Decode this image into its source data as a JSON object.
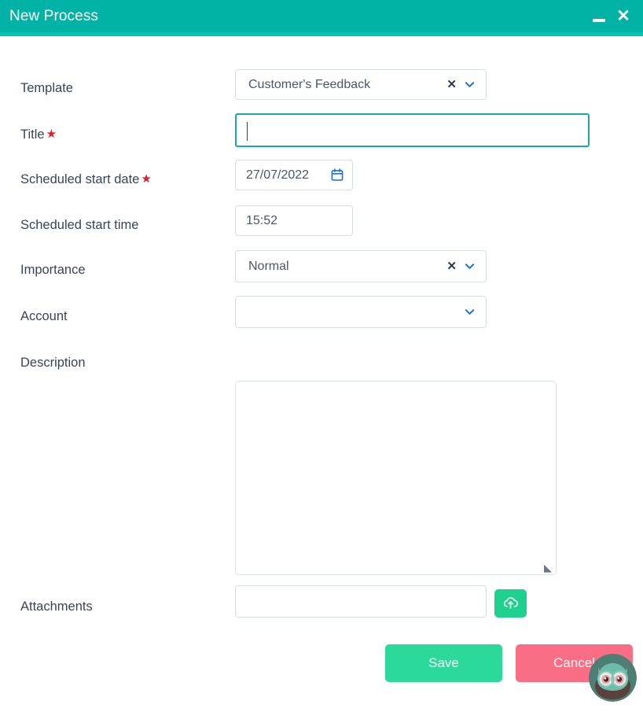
{
  "window": {
    "title": "New Process",
    "minimize_label": "—",
    "close_label": "✕",
    "accent_color": "#00b3a4"
  },
  "form": {
    "fields": [
      {
        "label": "Template",
        "required": false,
        "type": "select",
        "value": "Customer's Feedback",
        "placeholder": "",
        "has_clear": true,
        "has_chevron": true
      },
      {
        "label": "Title",
        "required": true,
        "type": "text",
        "value": "",
        "placeholder": "",
        "focused": true
      },
      {
        "label": "Scheduled start date",
        "required": true,
        "type": "date",
        "value": "27/07/2022",
        "placeholder": "",
        "has_calendar_icon": true
      },
      {
        "label": "Scheduled start time",
        "required": false,
        "type": "time",
        "value": "15:52",
        "placeholder": ""
      },
      {
        "label": "Importance",
        "required": false,
        "type": "select",
        "value": "Normal",
        "placeholder": "",
        "has_clear": true,
        "has_chevron": true
      },
      {
        "label": "Account",
        "required": false,
        "type": "select",
        "value": "",
        "placeholder": "",
        "has_clear": false,
        "has_chevron": true
      },
      {
        "label": "Description",
        "required": false,
        "type": "textarea",
        "value": "",
        "placeholder": ""
      },
      {
        "label": "Attachments",
        "required": false,
        "type": "file",
        "value": "",
        "placeholder": ""
      }
    ],
    "required_marker": "★",
    "resize_grip_glyph": "◢"
  },
  "icons": {
    "clear": "✕",
    "chevron_down": "chevron-down-icon",
    "calendar": "calendar-icon",
    "upload": "cloud-upload-icon",
    "owl": "owl-avatar-icon"
  },
  "footer": {
    "save_label": "Save",
    "cancel_label": "Cancel",
    "save_color": "#2bd99a",
    "cancel_color": "#fa6e85"
  },
  "colors": {
    "header": "#00b3a4",
    "header_underline": "#00c4b4",
    "focus_border": "#1aa9a9",
    "field_border": "#d6dce7",
    "label_text": "#3b4358",
    "value_text": "#4d5567",
    "icon_blue": "#1f6fd0",
    "required_red": "#e8192c",
    "upload_green": "#1fd18f"
  }
}
